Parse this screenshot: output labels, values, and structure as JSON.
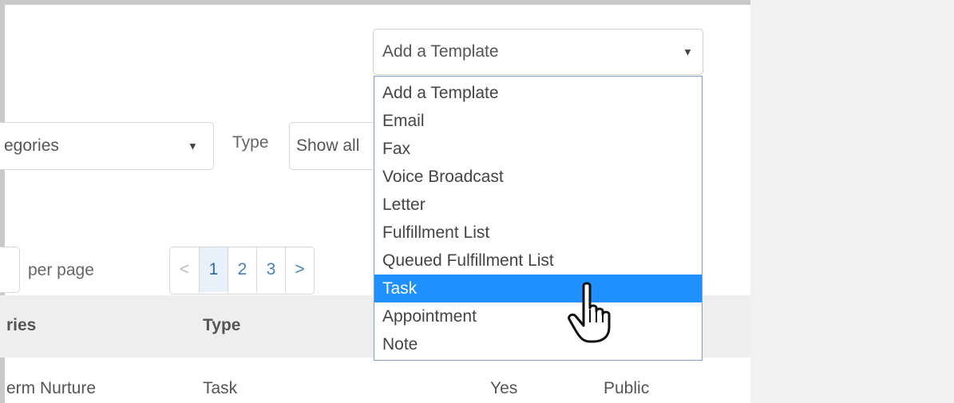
{
  "filters": {
    "categories_value": "egories",
    "type_label": "Type",
    "type_value": "Show all"
  },
  "template_select": {
    "selected": "Add a Template",
    "options": [
      "Add a Template",
      "Email",
      "Fax",
      "Voice Broadcast",
      "Letter",
      "Fulfillment List",
      "Queued Fulfillment List",
      "Task",
      "Appointment",
      "Note"
    ],
    "highlighted_option": "Task"
  },
  "pagination": {
    "per_page_label": "per page",
    "prev": "<",
    "pages": [
      "1",
      "2",
      "3"
    ],
    "next": ">",
    "current_page": "1"
  },
  "table": {
    "headers": [
      "ries",
      "Type"
    ],
    "rows": [
      {
        "category": "erm Nurture",
        "type": "Task",
        "flag": "Yes",
        "visibility": "Public"
      }
    ]
  },
  "icons": {
    "dropdown_arrow": "triangle-down-icon",
    "cursor": "hand-pointer-icon"
  },
  "colors": {
    "highlight": "#1e90ff",
    "page_link": "#4a7fb5",
    "right_panel": "#f1f1f1"
  }
}
